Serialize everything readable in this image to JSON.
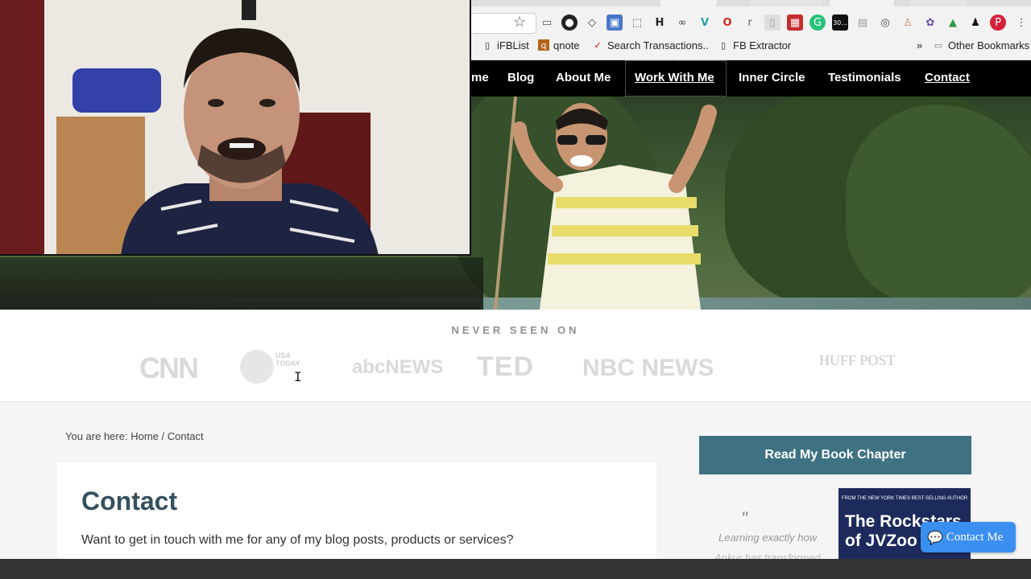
{
  "browser": {
    "bookmarks": [
      {
        "label": "iFBList",
        "icon": "page-icon"
      },
      {
        "label": "qnote",
        "icon": "qnote-icon"
      },
      {
        "label": "Search Transactions..",
        "icon": "check-icon"
      },
      {
        "label": "FB Extractor",
        "icon": "page-icon"
      }
    ],
    "more_label": "»",
    "other_bookmarks": "Other Bookmarks",
    "ext_badge": "30..."
  },
  "site_nav": {
    "items": [
      "me",
      "Blog",
      "About Me",
      "Work With Me",
      "Inner Circle",
      "Testimonials",
      "Contact"
    ]
  },
  "press": {
    "title": "NEVER SEEN ON",
    "logos": [
      "CNN",
      "USA TODAY",
      "abcNEWS",
      "TED",
      "NBC NEWS",
      "HUFF POST"
    ]
  },
  "breadcrumb": {
    "prefix": "You are here:",
    "home": "Home",
    "separator": "/",
    "current": "Contact"
  },
  "content": {
    "title": "Contact",
    "intro": "Want to get in touch with me for any of my blog posts, products or services?"
  },
  "sidebar": {
    "cta": "Read My Book Chapter",
    "quote_mark": "\"",
    "quote_line1": "Learning exactly how",
    "quote_line2": "Ankur has transformed",
    "book_top": "FROM THE NEW YORK TIMES BEST-SELLING AUTHOR",
    "book_title": "The Rockstars of JVZoo"
  },
  "contact_button": "Contact Me",
  "colors": {
    "nav_bg": "#000000",
    "cta_bg": "#3e7282",
    "title_color": "#35505e",
    "contact_btn": "#3b8ff0"
  }
}
